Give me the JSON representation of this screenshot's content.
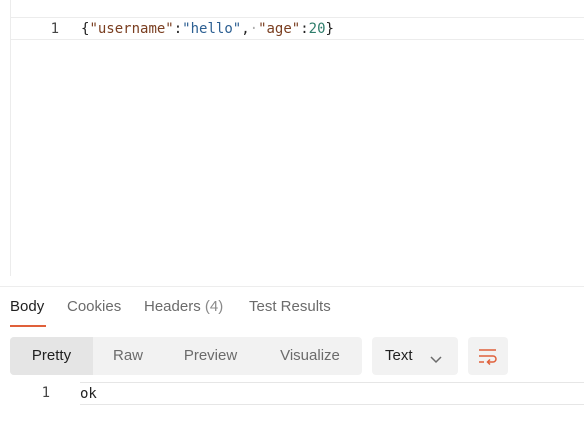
{
  "request_body": {
    "line_number": "1",
    "tokens": {
      "open_brace": "{",
      "key1": "\"username\"",
      "colon1": ":",
      "value1": "\"hello\"",
      "comma": ",",
      "space_marker": "·",
      "key2": "\"age\"",
      "colon2": ":",
      "value2": "20",
      "close_brace": "}"
    }
  },
  "response_tabs": {
    "body": "Body",
    "cookies": "Cookies",
    "headers": "Headers",
    "headers_count": "(4)",
    "test_results": "Test Results"
  },
  "format_toolbar": {
    "views": [
      "Pretty",
      "Raw",
      "Preview",
      "Visualize"
    ],
    "selected_view": "Pretty",
    "language": "Text"
  },
  "response_body": {
    "line_number": "1",
    "content": "ok"
  },
  "colors": {
    "accent": "#e0603a",
    "key": "#7a3e20",
    "string": "#2c5f92",
    "number": "#2e7d6b"
  },
  "icons": {
    "language_dropdown": "chevron-down-icon",
    "wrap_toggle": "wrap-lines-icon"
  }
}
